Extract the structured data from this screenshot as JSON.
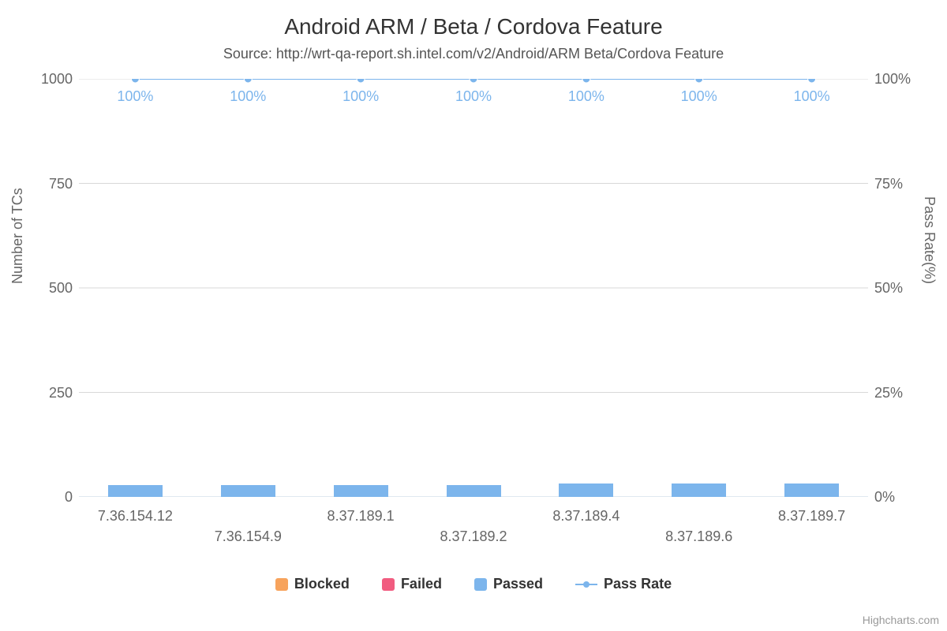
{
  "title": "Android ARM / Beta / Cordova Feature",
  "subtitle": "Source: http://wrt-qa-report.sh.intel.com/v2/Android/ARM Beta/Cordova Feature",
  "y_left": {
    "label": "Number of TCs",
    "ticks": [
      "0",
      "250",
      "500",
      "750",
      "1000"
    ]
  },
  "y_right": {
    "label": "Pass Rate(%)",
    "ticks": [
      "0%",
      "25%",
      "50%",
      "75%",
      "100%"
    ]
  },
  "data_labels": [
    "100%",
    "100%",
    "100%",
    "100%",
    "100%",
    "100%",
    "100%"
  ],
  "legend": {
    "blocked": "Blocked",
    "failed": "Failed",
    "passed": "Passed",
    "pass_rate": "Pass Rate"
  },
  "credits": "Highcharts.com",
  "colors": {
    "blocked": "#f7a35c",
    "failed": "#f15c80",
    "passed": "#7cb5ec",
    "line": "#7cb5ec",
    "grid": "#d8d8d8",
    "axis": "#c0d0e0",
    "text": "#666666"
  },
  "chart_data": {
    "type": "bar",
    "title": "Android ARM / Beta / Cordova Feature",
    "xlabel": "",
    "ylabel": "Number of TCs",
    "y2label": "Pass Rate(%)",
    "ylim": [
      0,
      1000
    ],
    "y2lim": [
      0,
      100
    ],
    "categories": [
      "7.36.154.12",
      "7.36.154.9",
      "8.37.189.1",
      "8.37.189.2",
      "8.37.189.4",
      "8.37.189.6",
      "8.37.189.7"
    ],
    "series": [
      {
        "name": "Blocked",
        "type": "column",
        "values": [
          0,
          0,
          0,
          0,
          0,
          0,
          0
        ]
      },
      {
        "name": "Failed",
        "type": "column",
        "values": [
          0,
          0,
          0,
          0,
          0,
          0,
          0
        ]
      },
      {
        "name": "Passed",
        "type": "column",
        "values": [
          30,
          30,
          30,
          30,
          34,
          34,
          34
        ]
      },
      {
        "name": "Pass Rate",
        "type": "line",
        "yAxis": 1,
        "values": [
          100,
          100,
          100,
          100,
          100,
          100,
          100
        ]
      }
    ],
    "grid": true,
    "legend_position": "bottom"
  }
}
